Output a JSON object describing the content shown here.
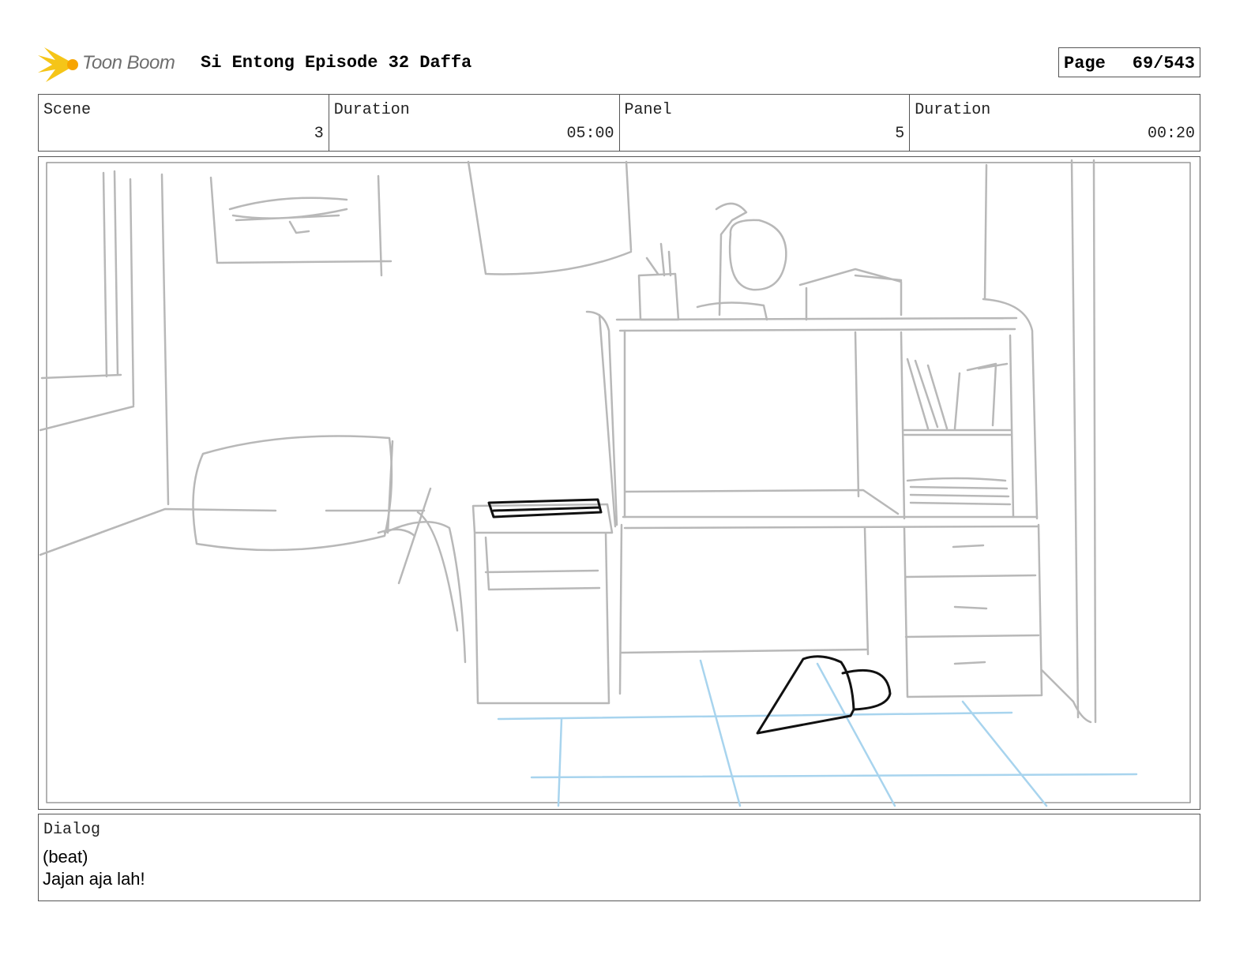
{
  "header": {
    "logo_text": "Toon Boom",
    "title": "Si Entong Episode 32 Daffa",
    "page_label": "Page",
    "page_number": "69/543"
  },
  "info": {
    "scene_label": "Scene",
    "scene_value": "3",
    "scene_duration_label": "Duration",
    "scene_duration_value": "05:00",
    "panel_label": "Panel",
    "panel_value": "5",
    "panel_duration_label": "Duration",
    "panel_duration_value": "00:20"
  },
  "dialog": {
    "label": "Dialog",
    "lines": [
      "(beat)",
      "Jajan aja lah!"
    ]
  },
  "colors": {
    "sketch_gray": "#b8b8b8",
    "floor_blue": "#a8d4ee",
    "ink_black": "#111111",
    "logo_yellow": "#f5c518"
  }
}
